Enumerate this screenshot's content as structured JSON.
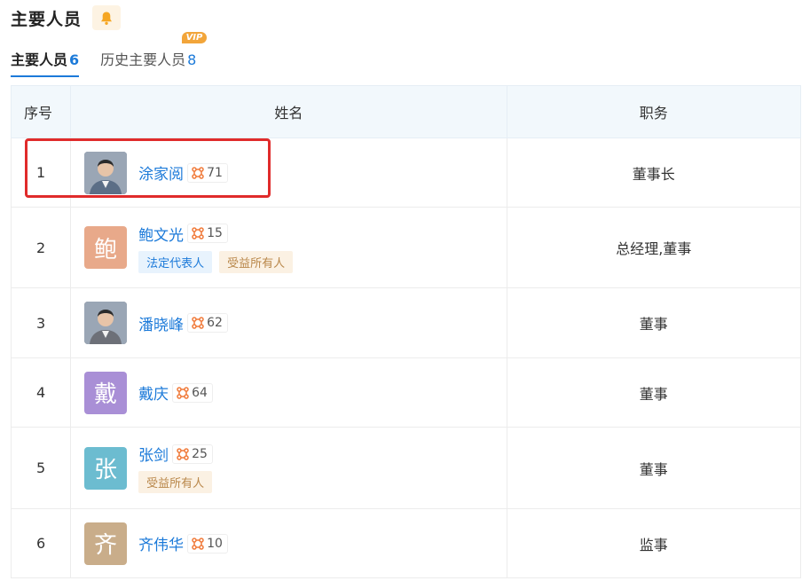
{
  "header": {
    "title": "主要人员",
    "bell_icon": "bell-icon"
  },
  "tabs": [
    {
      "label": "主要人员",
      "count": "6"
    },
    {
      "label": "历史主要人员",
      "count": "8",
      "badge": "VIP"
    }
  ],
  "table": {
    "columns": [
      "序号",
      "姓名",
      "职务"
    ],
    "rows": [
      {
        "index": "1",
        "name": "涂家阅",
        "relations": "71",
        "role": "董事长",
        "avatar_char": "",
        "avatar_color": "#5b6e86",
        "tags": []
      },
      {
        "index": "2",
        "name": "鲍文光",
        "relations": "15",
        "role": "总经理,董事",
        "avatar_char": "鲍",
        "avatar_color": "#e8a98a",
        "tags": [
          "法定代表人",
          "受益所有人"
        ]
      },
      {
        "index": "3",
        "name": "潘晓峰",
        "relations": "62",
        "role": "董事",
        "avatar_char": "",
        "avatar_color": "#6d7078",
        "tags": []
      },
      {
        "index": "4",
        "name": "戴庆",
        "relations": "64",
        "role": "董事",
        "avatar_char": "戴",
        "avatar_color": "#a98fd6",
        "tags": []
      },
      {
        "index": "5",
        "name": "张剑",
        "relations": "25",
        "role": "董事",
        "avatar_char": "张",
        "avatar_color": "#6cbcd0",
        "tags": [
          "受益所有人"
        ]
      },
      {
        "index": "6",
        "name": "齐伟华",
        "relations": "10",
        "role": "监事",
        "avatar_char": "齐",
        "avatar_color": "#c9ad8a",
        "tags": []
      }
    ]
  },
  "colors": {
    "accent": "#1c7ad9",
    "highlight": "#e02b2b",
    "vip": "#f2a53a",
    "relation_icon": "#f07a3a"
  },
  "icons": {
    "relation": "network-relation-icon",
    "bell": "bell-icon"
  }
}
